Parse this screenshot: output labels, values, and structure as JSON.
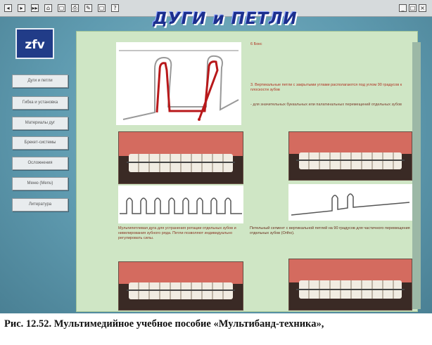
{
  "toolbar": {
    "buttons": [
      "◂",
      "▸",
      "▸▸",
      "⌂",
      "▢",
      "⎙",
      "✎",
      "▢",
      "?"
    ],
    "window_buttons": [
      "_",
      "□",
      "×"
    ]
  },
  "app": {
    "banner_title": "ДУГИ и ПЕТЛИ",
    "logo_text": "zfv"
  },
  "nav": {
    "items": [
      "Дуги и петли",
      "Гибка и установка",
      "Материалы дуг",
      "Брекет-системы",
      "Осложнения",
      "Меню (Menu)",
      "Литература"
    ]
  },
  "content": {
    "header_label": "6 Бокс",
    "note_main": "3. Вертикальные петли с закрытыми углами располагаются под углом 90 градусов к плоскости зубов",
    "note_sub": "- для значительных буккальных или палатинальных перемещений отдельных зубов",
    "desc_left": "Мультипетлевая дуга для устранения ротации отдельных зубов и нивелирования зубного ряда. Петли позволяют индивидуально регулировать силы.",
    "desc_right": "Петельный сегмент с вертикальной петлей на 90 градусов для частичного перемещения отдельных зубов (Ortho)."
  },
  "figure": {
    "caption": "Рис. 12.52. Мультимедийное учебное пособие «Мультибанд-техника»,"
  },
  "colors": {
    "screen_bg": "#5f9bb0",
    "panel_bg": "#cfe6c5",
    "banner": "#1c2f8e",
    "accent_text": "#b03020"
  }
}
